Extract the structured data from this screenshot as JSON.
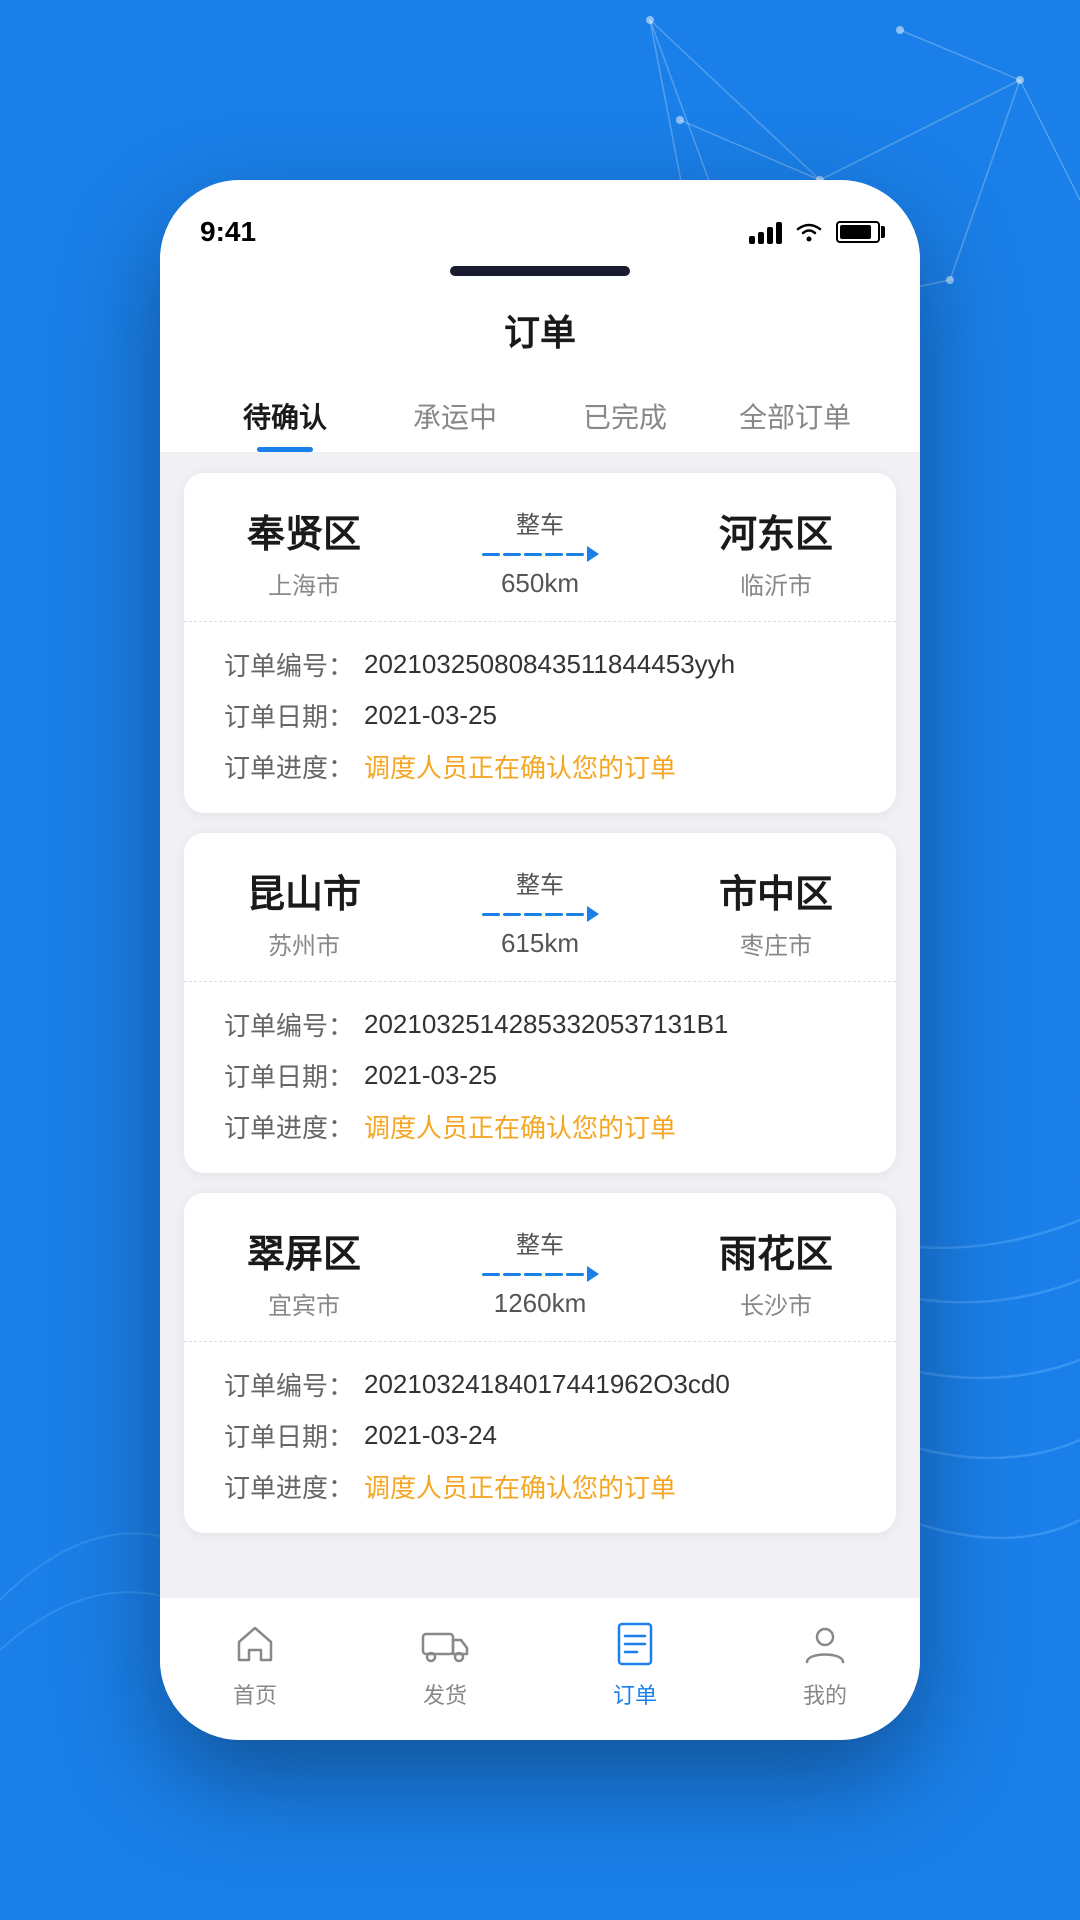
{
  "background": {
    "color": "#1a7fe8"
  },
  "status_bar": {
    "time": "9:41"
  },
  "page": {
    "title": "订单"
  },
  "tabs": [
    {
      "id": "pending",
      "label": "待确认",
      "active": true
    },
    {
      "id": "in_transit",
      "label": "承运中",
      "active": false
    },
    {
      "id": "completed",
      "label": "已完成",
      "active": false
    },
    {
      "id": "all",
      "label": "全部订单",
      "active": false
    }
  ],
  "orders": [
    {
      "from_city": "奉贤区",
      "from_province": "上海市",
      "to_city": "河东区",
      "to_province": "临沂市",
      "type": "整车",
      "distance": "650km",
      "order_no_label": "订单编号：",
      "order_no": "20210325080843511844453yyh",
      "order_date_label": "订单日期：",
      "order_date": "2021-03-25",
      "order_progress_label": "订单进度：",
      "order_progress": "调度人员正在确认您的订单"
    },
    {
      "from_city": "昆山市",
      "from_province": "苏州市",
      "to_city": "市中区",
      "to_province": "枣庄市",
      "type": "整车",
      "distance": "615km",
      "order_no_label": "订单编号：",
      "order_no": "20210325142853320537131B1",
      "order_date_label": "订单日期：",
      "order_date": "2021-03-25",
      "order_progress_label": "订单进度：",
      "order_progress": "调度人员正在确认您的订单"
    },
    {
      "from_city": "翠屏区",
      "from_province": "宜宾市",
      "to_city": "雨花区",
      "to_province": "长沙市",
      "type": "整车",
      "distance": "1260km",
      "order_no_label": "订单编号：",
      "order_no": "20210324184017441962O3cd0",
      "order_date_label": "订单日期：",
      "order_date": "2021-03-24",
      "order_progress_label": "订单进度：",
      "order_progress": "调度人员正在确认您的订单"
    }
  ],
  "bottom_nav": [
    {
      "id": "home",
      "label": "首页",
      "active": false
    },
    {
      "id": "shipping",
      "label": "发货",
      "active": false
    },
    {
      "id": "orders",
      "label": "订单",
      "active": true
    },
    {
      "id": "profile",
      "label": "我的",
      "active": false
    }
  ]
}
